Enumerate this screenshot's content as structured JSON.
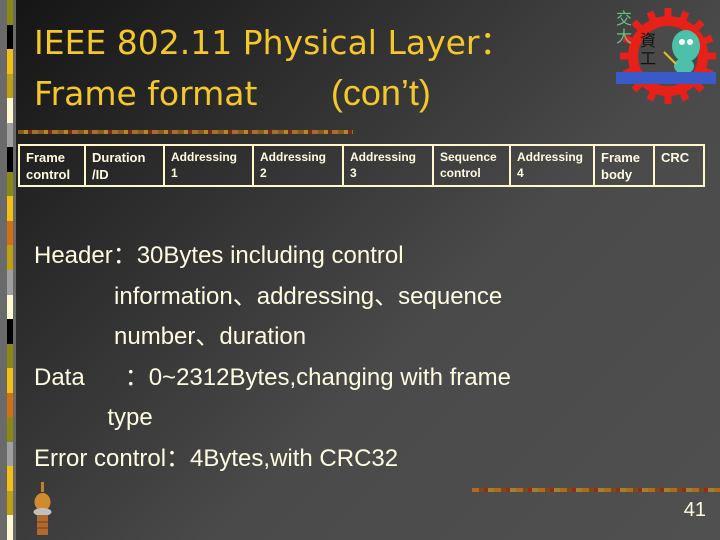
{
  "slide": {
    "title_line1": "IEEE 802.11 Physical Layer：",
    "title_line2": "Frame format",
    "title_cont": "(con’t)",
    "page_number": "41",
    "accent_color": "#f4c82a",
    "text_color": "#fffbe0"
  },
  "frame_fields": [
    {
      "label": "Frame\ncontrol"
    },
    {
      "label": "Duration\n/ID"
    },
    {
      "label": "Addressing\n1"
    },
    {
      "label": "Addressing\n2"
    },
    {
      "label": "Addressing\n3"
    },
    {
      "label": "Sequence\ncontrol"
    },
    {
      "label": "Addressing\n4"
    },
    {
      "label": "Frame\nbody"
    },
    {
      "label": "CRC"
    }
  ],
  "body_lines": [
    "Header：30Bytes including control",
    "            information、addressing、sequence",
    "            number、duration",
    "Data      ：0~2312Bytes,changing with frame",
    "           type",
    "Error control：4Bytes,with CRC32"
  ],
  "icons": {
    "logo": "university-gear-logo-icon",
    "figurine": "bell-figurine-icon"
  }
}
